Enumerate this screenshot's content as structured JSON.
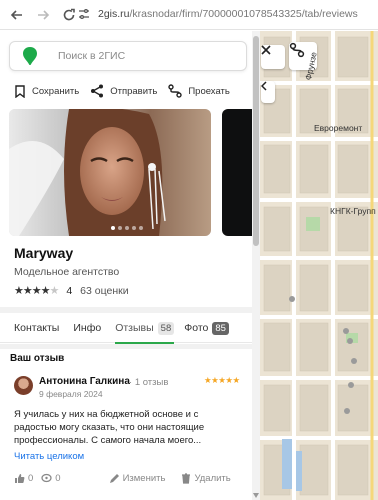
{
  "browser": {
    "url_domain": "2gis.ru",
    "url_path": "/krasnodar/firm/70000001078543325/tab/reviews"
  },
  "search": {
    "placeholder": "Поиск в 2ГИС"
  },
  "actions": {
    "save": "Сохранить",
    "share": "Отправить",
    "route": "Проехать"
  },
  "company": {
    "name": "Maryway",
    "category": "Модельное агентство",
    "rating_value": "4",
    "ratings_count": "63 оценки",
    "stars_filled": 4,
    "stars_total": 5
  },
  "tabs": [
    {
      "label": "Контакты",
      "badge": ""
    },
    {
      "label": "Инфо",
      "badge": ""
    },
    {
      "label": "Отзывы",
      "badge": "58"
    },
    {
      "label": "Фото",
      "badge": "85"
    }
  ],
  "review": {
    "section_title": "Ваш отзыв",
    "author": "Антонина Галкина",
    "author_reviews": "1 отзыв",
    "date": "9 февраля 2024",
    "stars": "★★★★★",
    "text": "Я училась у них на бюджетной основе и с радостью могу сказать, что они настоящие профессионалы. С самого начала моего...",
    "read_more": "Читать целиком",
    "likes": "0",
    "comments": "0",
    "edit": "Изменить",
    "delete": "Удалить"
  },
  "map": {
    "labels": [
      "Фрунзе",
      "Евроремонт",
      "КНГК-Групп"
    ]
  },
  "colors": {
    "brand_green": "#2ba84a",
    "link_blue": "#1a73e8",
    "star_orange": "#f5a623"
  }
}
